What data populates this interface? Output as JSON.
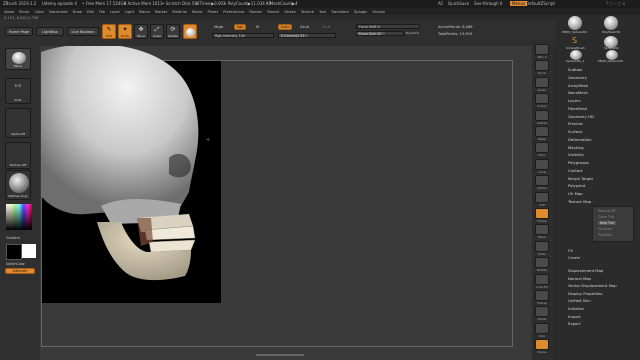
{
  "titlebar": {
    "title": "ZBrush 2019.1.2",
    "project": "Udemy episode 4",
    "free_mem": "• Free Mem 17.524GB",
    "active_mem": "• Active Mem 1013",
    "scratch_disk": "• Scratch Disk 582",
    "timer": "• Timer▶0.003",
    "polycount": "• PolyCount▶11.034 KP",
    "meshcount": "• MeshCount▶4",
    "ac": "AC",
    "quicksave": "QuickSave",
    "see_through": "See-through",
    "see_through_value": "0",
    "menus_btn": "Menus",
    "script": "DefaultZScript"
  },
  "menubar": [
    "Alpha",
    "Brush",
    "Color",
    "Document",
    "Draw",
    "Edit",
    "File",
    "Layer",
    "Light",
    "Macro",
    "Marker",
    "Material",
    "Movie",
    "Picker",
    "Preferences",
    "Render",
    "Stencil",
    "Stroke",
    "Texture",
    "Tool",
    "Transform",
    "Zplugin",
    "Zscript"
  ],
  "coords": "0.107,-0.241,0.736",
  "shelf": {
    "home_page": "Home Page",
    "lightbox": "LightBox",
    "live_boolean": "Live Boolean",
    "edit": "Edit",
    "draw": "Draw",
    "move": "Move",
    "scale": "Scale",
    "rotate": "Rotate",
    "mrgb": "Mrgb",
    "rgb": "Rgb",
    "m": "M",
    "zadd": "Zadd",
    "zsub": "Zsub",
    "zcut": "Zcut",
    "rgb_intensity": "Rgb Intensity 100",
    "z_intensity": "Z Intensity 51",
    "focal_shift": "Focal Shift 0",
    "draw_size": "Draw Size 42",
    "dynamic": "Dynamic",
    "active_points": "ActivePoints: 8,066",
    "total_points": "TotalPoints: 13,993"
  },
  "leftpanel": {
    "brush": "Move",
    "stroke": "Dots",
    "alpha": "Alpha Off",
    "texture": "Texture Off",
    "material": "MatCap Gray",
    "gradient": "Gradient",
    "switch_color": "SwitchColor",
    "alternate": "Alternate"
  },
  "rshelf": [
    "SPix 3",
    "Scroll",
    "Zoom",
    "Actual",
    "AAHalf",
    "Persp",
    "Floor",
    "Local",
    "Gizmo",
    "XYZ",
    "Frame",
    "Move",
    "Scale",
    "Rotate",
    "Line Fill PolyF",
    "Transp",
    "Ghost",
    "Solo",
    "Xpose"
  ],
  "rpanel": {
    "tools": [
      "PM3D_Sphere3D",
      "PolyMesh3D",
      "SimpleBrush",
      "Sphere3D",
      "Sphere3D_1",
      "PM3D_Sphere3D"
    ],
    "items": [
      "Subtool",
      "Geometry",
      "ArrayMesh",
      "NanoMesh",
      "Layers",
      "FiberMesh",
      "Geometry HD",
      "Preview",
      "Surface",
      "Deformation",
      "Masking",
      "Visibility",
      "Polygroups",
      "Contact",
      "Morph Target",
      "Polypaint",
      "UV Map",
      "Texture Map"
    ],
    "texture_sub": [
      "Texture Off",
      "Clone Txtr",
      "New Txtr",
      "Fix Seam",
      "PolyPaint"
    ],
    "texture_fill": "Fill",
    "texture_create": "Create",
    "items_after": [
      "Displacement Map",
      "Normal Map",
      "Vector Displacement Map",
      "Display Properties",
      "Unified Skin",
      "Initialize",
      "Import",
      "Export"
    ]
  },
  "colors": {
    "accent": "#e08a2e",
    "canvas_bg": "#3a3a3a",
    "document": "#000000"
  }
}
